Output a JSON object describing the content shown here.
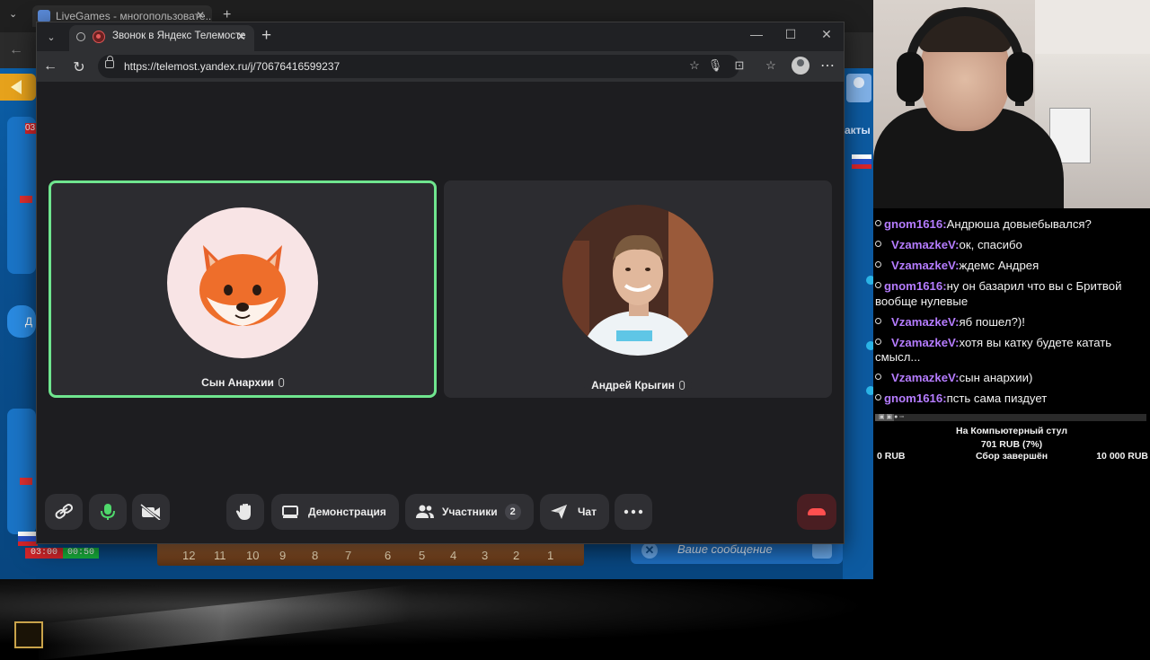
{
  "background_window": {
    "tab_title": "LiveGames - многопользовате...",
    "message_placeholder": "Ваше сообщение",
    "side_label": "акты",
    "timer_left": "03:00",
    "timer_right": "00:50",
    "timer_top": "03",
    "pill_label": "Д",
    "board_points": [
      "12",
      "11",
      "10",
      "9",
      "8",
      "7",
      "6",
      "5",
      "4",
      "3",
      "2",
      "1"
    ]
  },
  "browser": {
    "tab_title": "Звонок в Яндекс Телемосте",
    "url": "https://telemost.yandex.ru/j/70676416599237"
  },
  "call": {
    "participants": [
      {
        "name": "Сын Анархии",
        "active": true,
        "avatar": "fox-emoji"
      },
      {
        "name": "Андрей Крыгин",
        "active": false,
        "avatar": "photo"
      }
    ],
    "controls": {
      "link_icon": "link-icon",
      "mic_icon": "mic-icon",
      "camera_icon": "camera-off-icon",
      "hand_icon": "raise-hand-icon",
      "demo_label": "Демонстрация",
      "participants_label": "Участники",
      "participants_count": "2",
      "chat_label": "Чат",
      "more_icon": "more-icon",
      "end_icon": "end-call-icon"
    },
    "colors": {
      "active_border": "#6fe58e",
      "end_call": "#ff4f4f",
      "mic_on": "#4fd86b"
    }
  },
  "stream_chat": {
    "messages": [
      {
        "nick": "gnom1616:",
        "text": "Андрюша довыебывался?"
      },
      {
        "nick": "VzamazkeV:",
        "text": "ок, спасибо"
      },
      {
        "nick": "VzamazkeV:",
        "text": "ждемс Андрея"
      },
      {
        "nick": "gnom1616:",
        "text": "ну он базарил что вы с Бритвой вообще нулевые"
      },
      {
        "nick": "VzamazkeV:",
        "text": "яб пошел?)!"
      },
      {
        "nick": "VzamazkeV:",
        "text": "хотя вы катку будете катать смысл..."
      },
      {
        "nick": "VzamazkeV:",
        "text": "сын анархии)"
      },
      {
        "nick": "gnom1616:",
        "text": "псть сама пиздует"
      }
    ],
    "nick_color": "#b57cff"
  },
  "goal": {
    "title": "На Компьютерный стул",
    "amount": "701 RUB (7%)",
    "progress": 0.07,
    "min": "0 RUB",
    "status": "Сбор завершён",
    "max": "10 000 RUB"
  }
}
